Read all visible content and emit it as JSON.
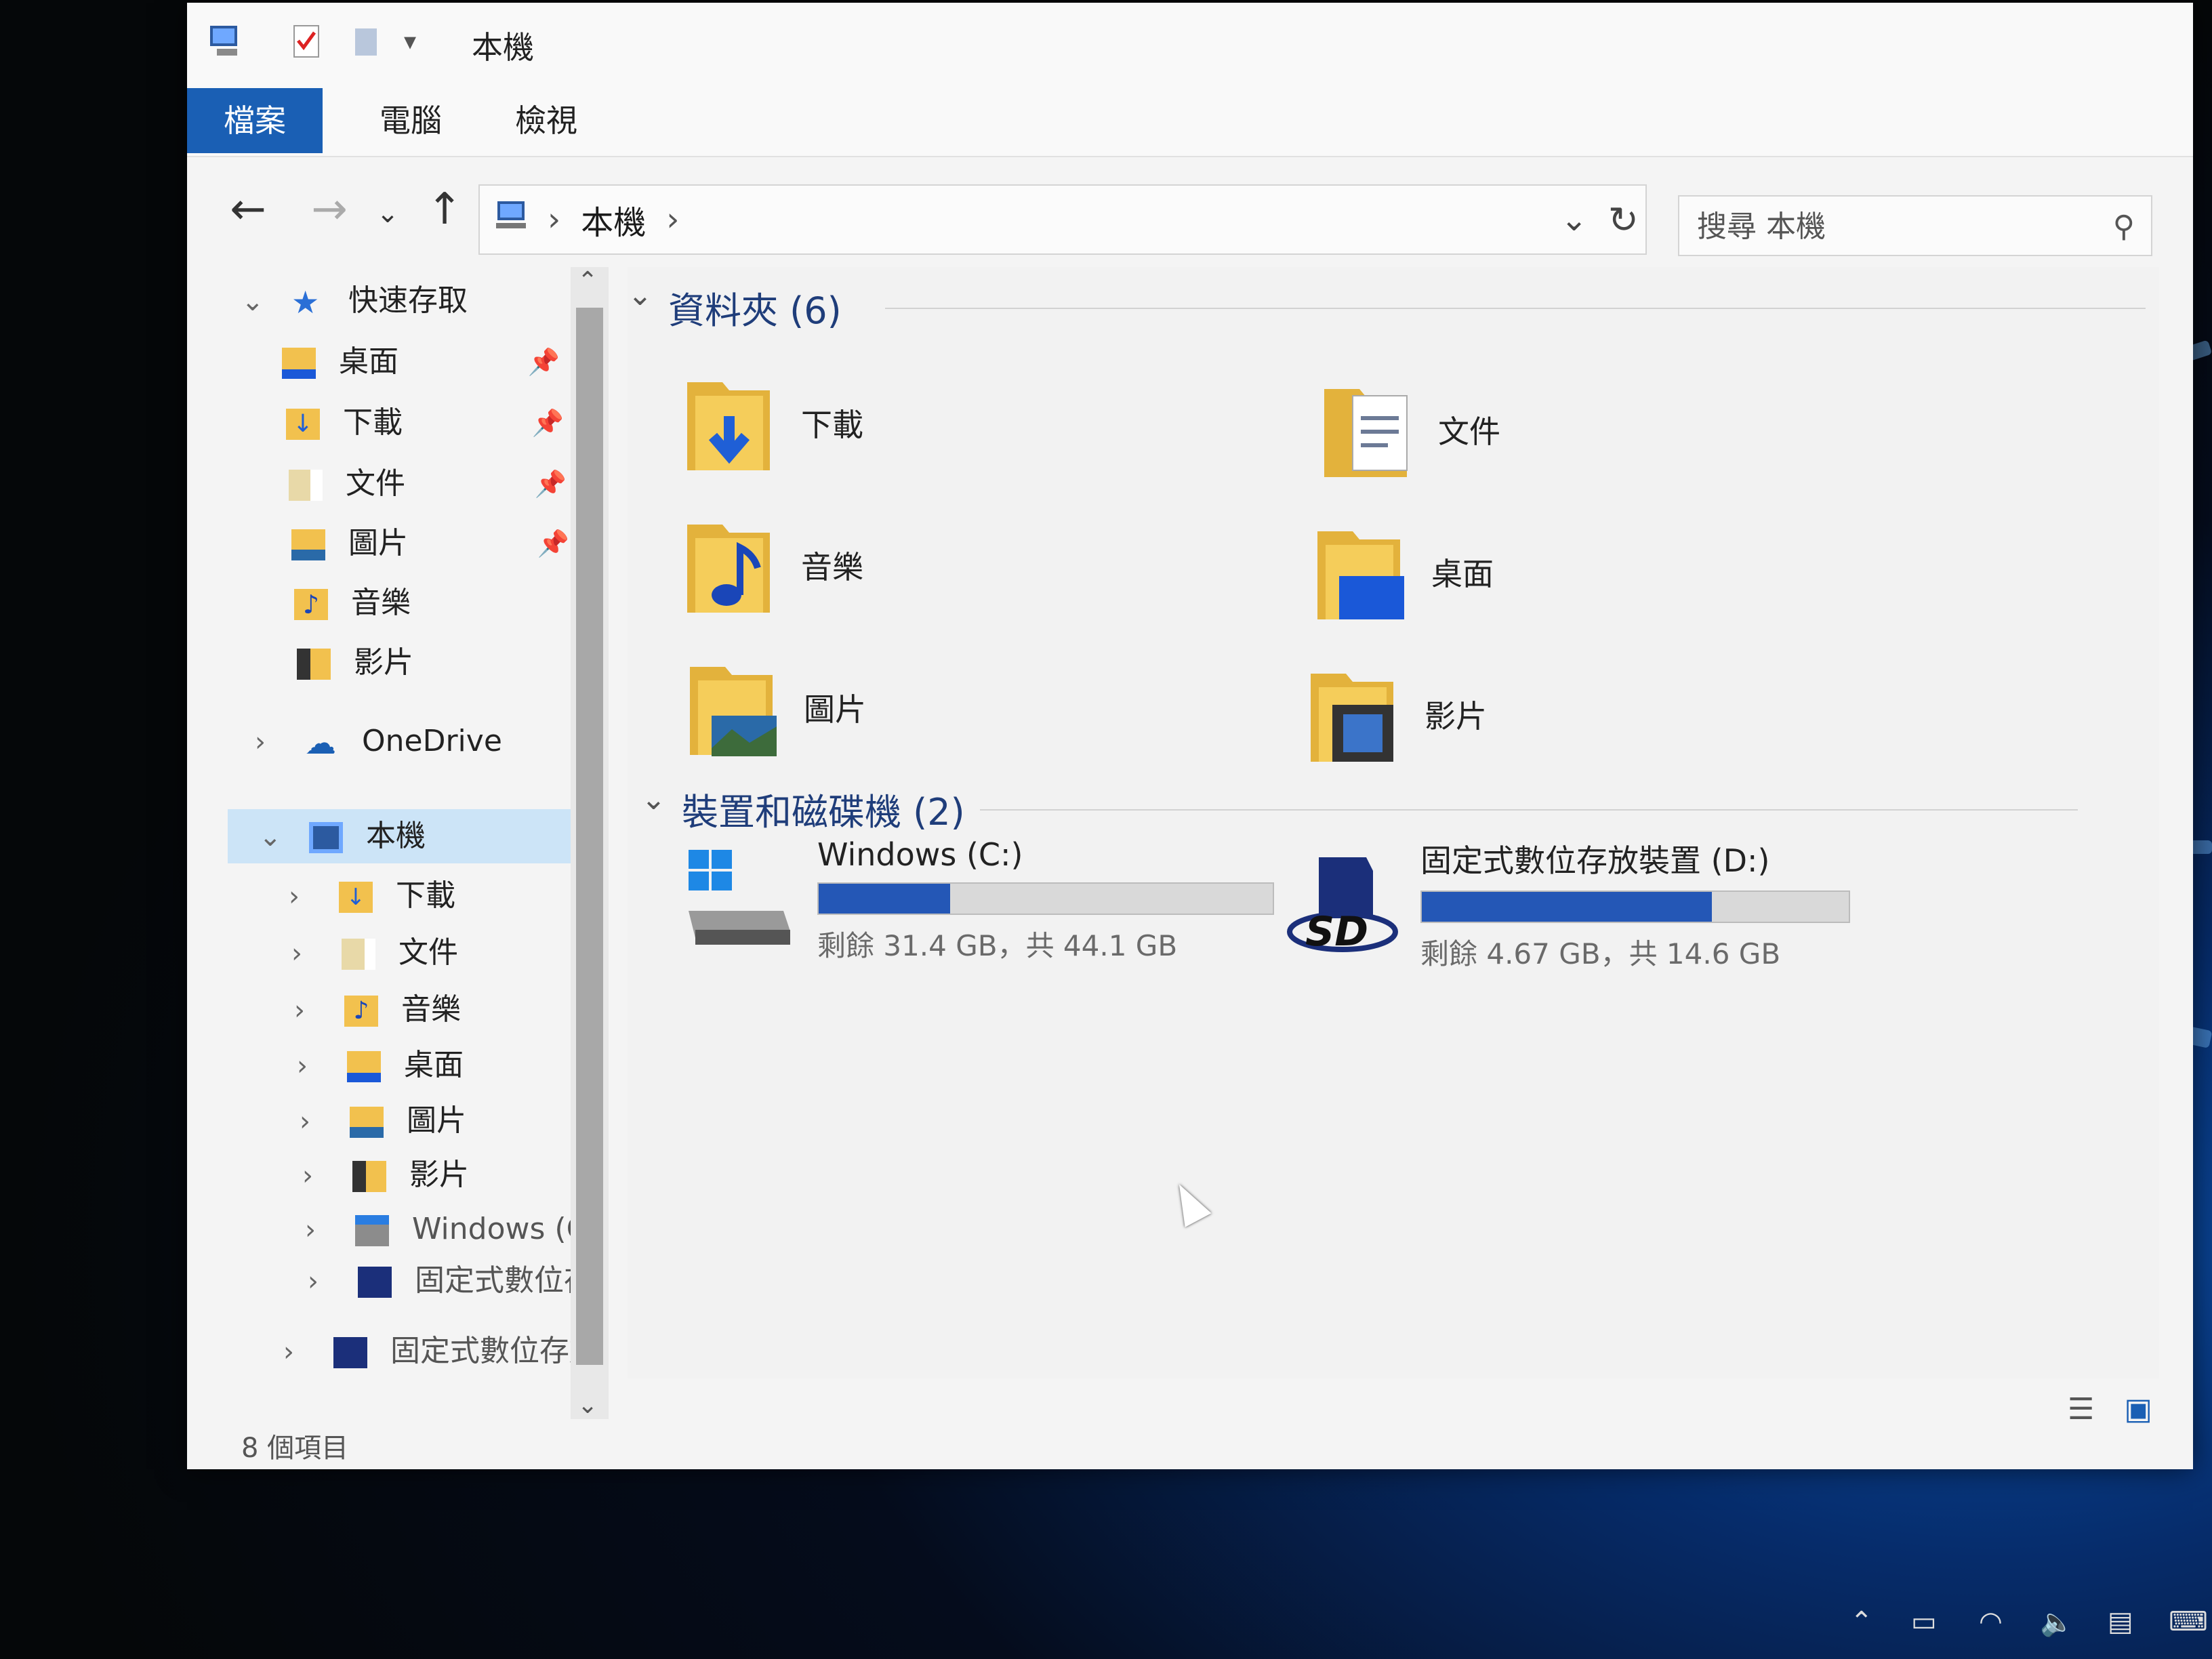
{
  "window": {
    "title": "本機",
    "controls": {
      "minimize": "—",
      "maximize": "☐",
      "close": "✕"
    }
  },
  "ribbon": {
    "tabs": [
      {
        "label": "檔案"
      },
      {
        "label": "電腦"
      },
      {
        "label": "檢視"
      }
    ],
    "collapse_glyph": "⌄",
    "help_glyph": "?"
  },
  "address": {
    "path": "本機",
    "separator": "›",
    "refresh": "↻",
    "dropdown": "⌄"
  },
  "search": {
    "placeholder": "搜尋 本機"
  },
  "sidebar": {
    "quick_access": {
      "label": "快速存取",
      "items": [
        {
          "label": "桌面",
          "pinned": true
        },
        {
          "label": "下載",
          "pinned": true
        },
        {
          "label": "文件",
          "pinned": true
        },
        {
          "label": "圖片",
          "pinned": true
        },
        {
          "label": "音樂",
          "pinned": false
        },
        {
          "label": "影片",
          "pinned": false
        }
      ]
    },
    "onedrive": {
      "label": "OneDrive"
    },
    "this_pc": {
      "label": "本機",
      "items": [
        {
          "label": "下載"
        },
        {
          "label": "文件"
        },
        {
          "label": "音樂"
        },
        {
          "label": "桌面"
        },
        {
          "label": "圖片"
        },
        {
          "label": "影片"
        },
        {
          "label": "Windows (C:)"
        },
        {
          "label": "固定式數位存放裝置 (D:)"
        }
      ]
    },
    "extra_item": {
      "label": "固定式數位存放裝置 (D:)"
    }
  },
  "main": {
    "folders_header": "資料夾 (6)",
    "folders": [
      {
        "label": "下載",
        "accent": "#1f5fd6"
      },
      {
        "label": "文件",
        "accent": "#6c7a96"
      },
      {
        "label": "音樂",
        "accent": "#1a46b8"
      },
      {
        "label": "桌面",
        "accent": "#1a58d8"
      },
      {
        "label": "圖片",
        "accent": "#2a6aa8"
      },
      {
        "label": "影片",
        "accent": "#333333"
      }
    ],
    "drives_header": "裝置和磁碟機 (2)",
    "drives": [
      {
        "name": "Windows (C:)",
        "free_text": "剩餘 31.4 GB，共 44.1 GB",
        "used_fraction": 0.29
      },
      {
        "name": "固定式數位存放裝置 (D:)",
        "free_text": "剩餘 4.67 GB，共 14.6 GB",
        "used_fraction": 0.68
      }
    ]
  },
  "status": {
    "item_count": "8 個項目"
  },
  "colors": {
    "accent": "#1a5fb4",
    "selection": "#cce4f7",
    "bar_fill": "#2457b6"
  }
}
